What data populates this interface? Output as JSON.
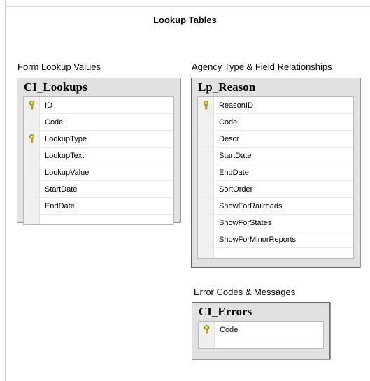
{
  "title": "Lookup Tables",
  "groups": {
    "lookups": {
      "label": "Form Lookup Values",
      "table_name": "CI_Lookups",
      "columns": [
        {
          "name": "ID",
          "key": true
        },
        {
          "name": "Code",
          "key": false
        },
        {
          "name": "LookupType",
          "key": true
        },
        {
          "name": "LookupText",
          "key": false
        },
        {
          "name": "LookupValue",
          "key": false
        },
        {
          "name": "StartDate",
          "key": false
        },
        {
          "name": "EndDate",
          "key": false
        }
      ]
    },
    "reason": {
      "label": "Agency Type & Field Relationships",
      "table_name": "Lp_Reason",
      "columns": [
        {
          "name": "ReasonID",
          "key": true
        },
        {
          "name": "Code",
          "key": false
        },
        {
          "name": "Descr",
          "key": false
        },
        {
          "name": "StartDate",
          "key": false
        },
        {
          "name": "EndDate",
          "key": false
        },
        {
          "name": "SortOrder",
          "key": false
        },
        {
          "name": "ShowForRailroads",
          "key": false
        },
        {
          "name": "ShowForStates",
          "key": false
        },
        {
          "name": "ShowForMinorReports",
          "key": false
        }
      ]
    },
    "errors": {
      "label": "Error Codes & Messages",
      "table_name": "CI_Errors",
      "columns": [
        {
          "name": "Code",
          "key": true
        }
      ]
    }
  }
}
